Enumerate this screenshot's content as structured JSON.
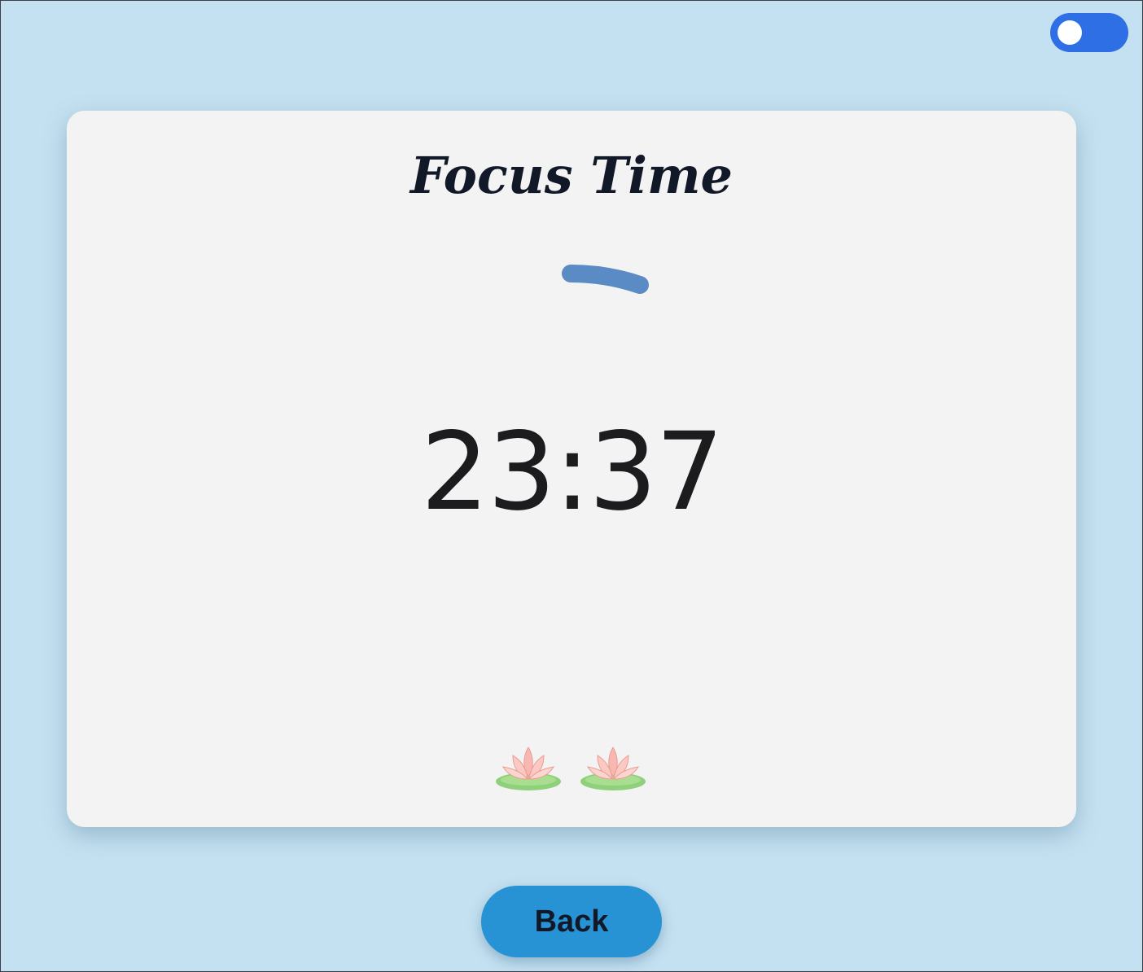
{
  "app": {
    "theme_toggle": {
      "state": "off",
      "accent": "#2f6fe6"
    }
  },
  "card": {
    "title": "Focus Time",
    "timer_text": "23:37",
    "decorations": [
      "lotus-icon",
      "lotus-icon"
    ]
  },
  "nav": {
    "back_label": "Back"
  },
  "colors": {
    "background": "#c4e1f1",
    "card": "#f3f3f4",
    "spinner": "#5a8bc4",
    "button": "#2793d4"
  }
}
